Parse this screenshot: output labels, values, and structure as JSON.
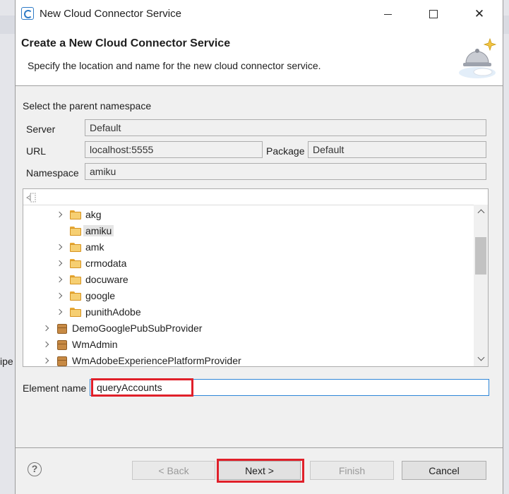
{
  "background": {
    "cut_text": "ipe"
  },
  "window": {
    "title": "New Cloud Connector Service",
    "controls": {
      "minimize": "—",
      "maximize": "☐",
      "close": "✕"
    }
  },
  "banner": {
    "title": "Create a New Cloud Connector Service",
    "description": "Specify the location and name for the new cloud connector service."
  },
  "form": {
    "section_label": "Select the parent namespace",
    "server_label": "Server",
    "server_value": "Default",
    "url_label": "URL",
    "url_value": "localhost:5555",
    "package_label": "Package",
    "package_value": "Default",
    "namespace_label": "Namespace",
    "namespace_value": "amiku"
  },
  "tree": {
    "folders": [
      {
        "label": "akg",
        "selected": false
      },
      {
        "label": "amiku",
        "selected": true
      },
      {
        "label": "amk",
        "selected": false
      },
      {
        "label": "crmodata",
        "selected": false
      },
      {
        "label": "docuware",
        "selected": false
      },
      {
        "label": "google",
        "selected": false
      },
      {
        "label": "punithAdobe",
        "selected": false
      }
    ],
    "packages": [
      {
        "label": "DemoGooglePubSubProvider"
      },
      {
        "label": "WmAdmin"
      },
      {
        "label": "WmAdobeExperiencePlatformProvider"
      }
    ]
  },
  "element": {
    "label": "Element name",
    "value": "queryAccounts"
  },
  "buttons": {
    "help": "?",
    "back": "< Back",
    "next": "Next >",
    "finish": "Finish",
    "cancel": "Cancel"
  },
  "colors": {
    "highlight": "#e0202a",
    "focus_border": "#2e86d8",
    "folder": "#f6cf72",
    "package": "#c78a44"
  }
}
